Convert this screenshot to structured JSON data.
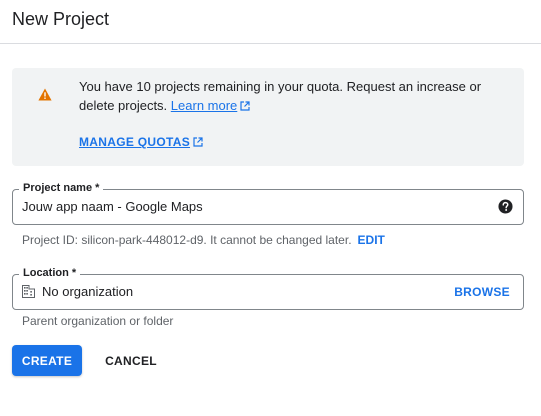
{
  "dialog": {
    "title": "New Project"
  },
  "quota": {
    "message": "You have 10 projects remaining in your quota. Request an increase or delete projects.",
    "learn_more": "Learn more",
    "manage_quotas": "MANAGE QUOTAS",
    "icon": "warning-icon",
    "warning_color": "#e37400"
  },
  "project_name": {
    "label": "Project name *",
    "value": "Jouw app naam - Google Maps",
    "help_icon": "help-icon"
  },
  "project_id": {
    "text": "Project ID: silicon-park-448012-d9. It cannot be changed later.",
    "edit": "EDIT"
  },
  "location": {
    "label": "Location *",
    "value": "No organization",
    "icon": "building-icon",
    "browse": "BROWSE",
    "hint": "Parent organization or folder"
  },
  "actions": {
    "create": "CREATE",
    "cancel": "CANCEL"
  },
  "colors": {
    "accent": "#1a73e8",
    "panel_bg": "#f1f3f4",
    "text": "#202124",
    "muted": "#5f6368"
  }
}
